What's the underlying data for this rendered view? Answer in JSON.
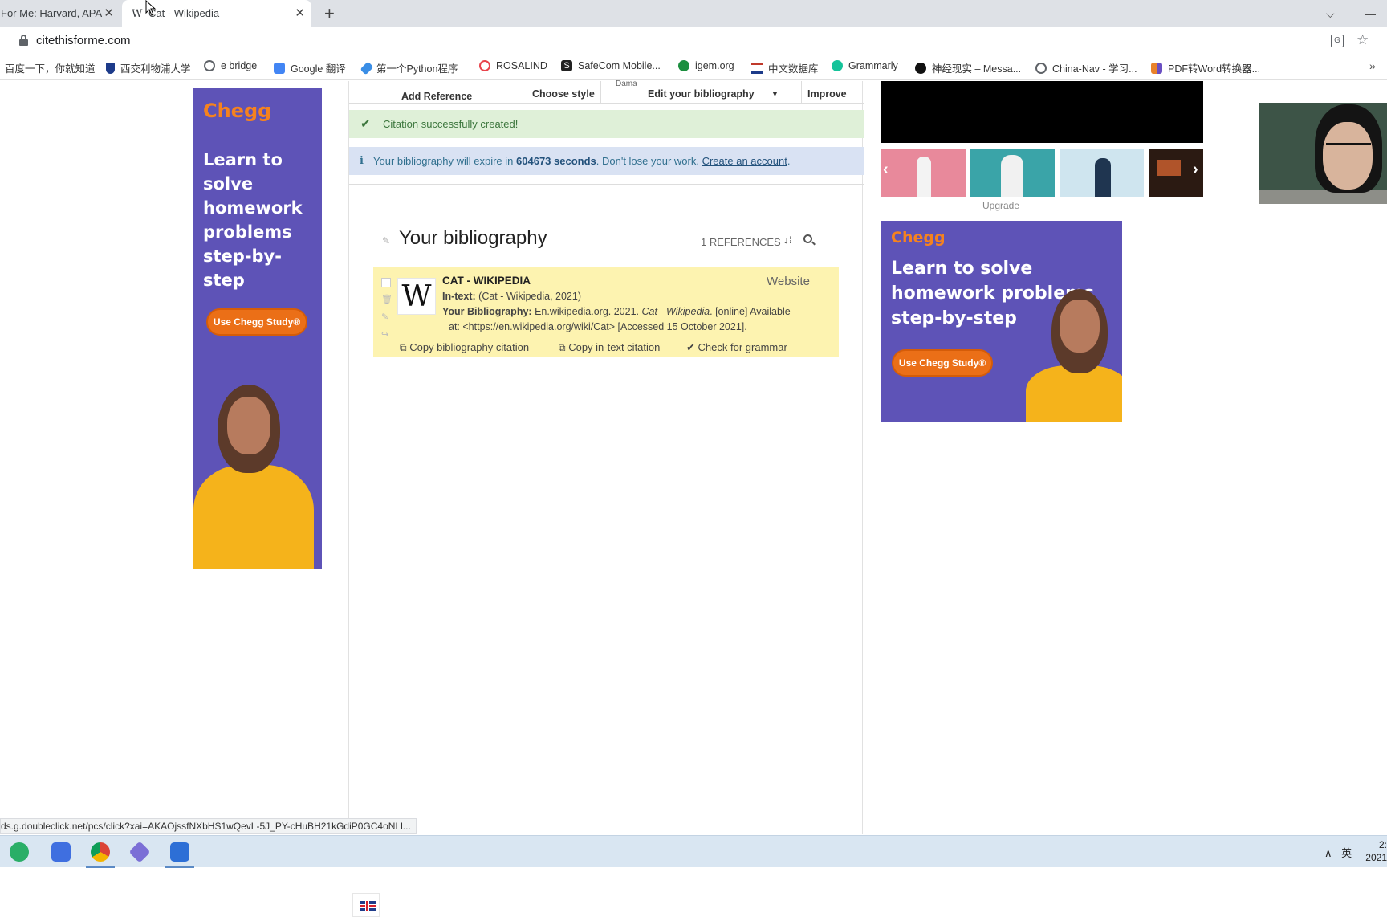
{
  "browser": {
    "tabs": [
      {
        "title": "For Me: Harvard, APA"
      },
      {
        "title": "Cat - Wikipedia",
        "favicon": "W"
      }
    ],
    "new_tab": "+",
    "url": "citethisforme.com",
    "bookmarks": [
      {
        "label": "百度一下，你就知道",
        "icon": "baidu-icon",
        "color": "#ffffff"
      },
      {
        "label": "西交利物浦大学",
        "icon": "xjtlu-shield-icon",
        "color": "#1d3b8a"
      },
      {
        "label": "e bridge",
        "icon": "globe-icon",
        "color": "#5f6368"
      },
      {
        "label": "Google 翻译",
        "icon": "google-translate-icon",
        "color": "#4285f4"
      },
      {
        "label": "第一个Python程序",
        "icon": "rocket-icon",
        "color": "#3a8ee6"
      },
      {
        "label": "ROSALIND",
        "icon": "rosalind-icon",
        "color": "#e8434b"
      },
      {
        "label": "SafeCom Mobile...",
        "icon": "safecom-icon",
        "color": "#222222"
      },
      {
        "label": "igem.org",
        "icon": "igem-icon",
        "color": "#1b8e3e"
      },
      {
        "label": "中文数据库",
        "icon": "database-icon",
        "color": "#c0392b"
      },
      {
        "label": "Grammarly",
        "icon": "grammarly-icon",
        "color": "#15c39a"
      },
      {
        "label": "神经现实 – Messa...",
        "icon": "neuro-icon",
        "color": "#111111"
      },
      {
        "label": "China-Nav - 学习...",
        "icon": "globe-icon",
        "color": "#5f6368"
      },
      {
        "label": "PDF转Word转换器...",
        "icon": "pdf-icon",
        "color": "#e9822a"
      }
    ],
    "more_bookmarks": "»"
  },
  "nav": {
    "add_reference": "Add Reference",
    "choose_style": "Choose style",
    "edit_bibliography": "Edit your bibliography",
    "improve": "Improve",
    "partial": "Dama"
  },
  "alerts": {
    "success": "Citation successfully created!",
    "info_prefix": "Your bibliography will expire in",
    "info_seconds": "604673 seconds",
    "info_middle": ". Don't lose your work.",
    "info_link": "Create an account",
    "info_suffix": "."
  },
  "bibliography": {
    "title": "Your bibliography",
    "ref_count": "1 REFERENCES ·",
    "reference": {
      "title": "CAT - WIKIPEDIA",
      "type": "Website",
      "intext_label": "In-text:",
      "intext_value": "(Cat - Wikipedia, 2021)",
      "bib_label": "Your Bibliography:",
      "bib_part1": "En.wikipedia.org. 2021.",
      "bib_italic": "Cat - Wikipedia",
      "bib_part2": ". [online] Available",
      "bib_line2": "at: <https://en.wikipedia.org/wiki/Cat> [Accessed 15 October 2021].",
      "actions": {
        "copy_bib": "Copy bibliography citation",
        "copy_intext": "Copy in-text citation",
        "check_grammar": "Check for grammar"
      }
    }
  },
  "ads": {
    "left": {
      "logo": "Chegg",
      "headline": [
        "Learn to",
        "solve",
        "homework",
        "problems",
        "step-by-step"
      ],
      "button": "Use Chegg Study®"
    },
    "right": {
      "logo": "Chegg",
      "headline": [
        "Learn to solve",
        "homework problems",
        "step-by-step"
      ],
      "button": "Use Chegg Study®"
    }
  },
  "video": {
    "upgrade": "Upgrade"
  },
  "status_url": "ds.g.doubleclick.net/pcs/click?xai=AKAOjssfNXbHS1wQevL-5J_PY-cHuBH21kGdiP0GC4oNLl...",
  "taskbar": {
    "ime": "英",
    "clock_top": "2:",
    "clock_bottom": "2021"
  },
  "colors": {
    "chegg_purple": "#5e53b7",
    "chegg_orange": "#eb6f17",
    "success_bg": "#dff0d8",
    "info_bg": "#d9e2f3",
    "ref_card_bg": "#fdf3b0"
  }
}
